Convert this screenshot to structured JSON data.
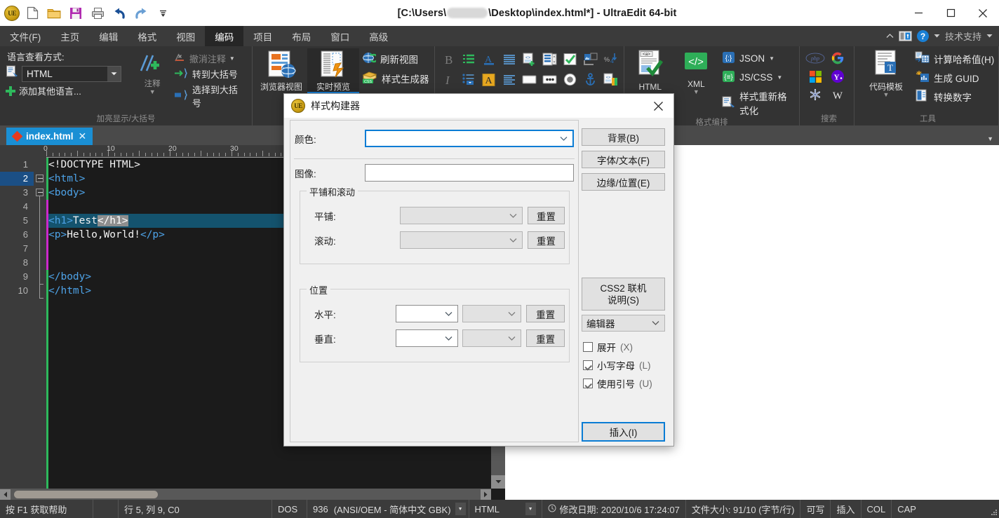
{
  "window": {
    "title_prefix": "[C:\\Users\\",
    "title_suffix": "\\Desktop\\index.html*] - UltraEdit 64-bit",
    "app_logo_text": "UE"
  },
  "quick_access": [
    {
      "name": "new-file-icon",
      "label": "新建"
    },
    {
      "name": "open-folder-icon",
      "label": "打开"
    },
    {
      "name": "save-icon",
      "label": "保存"
    },
    {
      "name": "print-icon",
      "label": "打印"
    },
    {
      "name": "undo-icon",
      "label": "撤销"
    },
    {
      "name": "redo-icon",
      "label": "重做"
    },
    {
      "name": "customize-qat-icon",
      "label": "自定义"
    }
  ],
  "window_controls": {
    "minimize": "minimize-icon",
    "maximize": "maximize-icon",
    "close": "close-icon"
  },
  "menubar": {
    "tabs": [
      {
        "label": "文件(F)",
        "active": false
      },
      {
        "label": "主页",
        "active": false
      },
      {
        "label": "编辑",
        "active": false
      },
      {
        "label": "格式",
        "active": false
      },
      {
        "label": "视图",
        "active": false
      },
      {
        "label": "编码",
        "active": true
      },
      {
        "label": "项目",
        "active": false
      },
      {
        "label": "布局",
        "active": false
      },
      {
        "label": "窗口",
        "active": false
      },
      {
        "label": "高级",
        "active": false
      }
    ],
    "support_label": "技术支持"
  },
  "ribbon": {
    "language_group": {
      "title": "语言查看方式:",
      "selected_language": "HTML",
      "add_other_language": "添加其他语言...",
      "comment_label": "注释",
      "uncomment_label": "撤消注释",
      "goto_brace": "转到大括号",
      "select_to_brace": "选择到大括号",
      "group_label": "加亮显示/大括号"
    },
    "preview_group": {
      "browser_view": "浏览器视图",
      "live_preview": "实时预览",
      "refresh_view": "刷新视图",
      "style_generator": "样式生成器"
    },
    "format_group": {
      "html_label": "HTML",
      "xml_label": "XML",
      "json_label": "JSON",
      "jscss_label": "JS/CSS",
      "style_reformat": "样式重新格式化",
      "group_label": "格式编排"
    },
    "search_group": {
      "group_label": "搜索",
      "engines": [
        "php-icon",
        "google-icon",
        "microsoft-icon",
        "yahoo-icon",
        "snowflake-icon",
        "wikipedia-icon"
      ]
    },
    "tools_group": {
      "code_template": "代码模板",
      "hash_value": "计算哈希值(H)",
      "generate_guid": "生成 GUID",
      "convert_number": "转换数字",
      "group_label": "工具"
    }
  },
  "editor": {
    "tab_label": "index.html",
    "ruler_marks": [
      "0",
      "10",
      "20",
      "30"
    ],
    "lines": [
      {
        "num": "1",
        "tokens": [
          {
            "t": "<!DOCTYPE HTML>",
            "c": "dtdc"
          }
        ]
      },
      {
        "num": "2",
        "tokens": [
          {
            "t": "<html>",
            "c": "tagc"
          }
        ]
      },
      {
        "num": "3",
        "tokens": [
          {
            "t": "<body>",
            "c": "tagc"
          }
        ]
      },
      {
        "num": "4",
        "tokens": []
      },
      {
        "num": "5",
        "tokens": [
          {
            "t": "<h1>",
            "c": "tagc"
          },
          {
            "t": "Test",
            "c": "txtc"
          },
          {
            "t": "</h1>",
            "c": "tagc"
          }
        ]
      },
      {
        "num": "6",
        "tokens": [
          {
            "t": "<p>",
            "c": "tagc"
          },
          {
            "t": "Hello,World!",
            "c": "txtc"
          },
          {
            "t": "</p>",
            "c": "tagc"
          }
        ]
      },
      {
        "num": "7",
        "tokens": []
      },
      {
        "num": "8",
        "tokens": []
      },
      {
        "num": "9",
        "tokens": [
          {
            "t": "</body>",
            "c": "tagc"
          }
        ]
      },
      {
        "num": "10",
        "tokens": [
          {
            "t": "</html>",
            "c": "tagc"
          }
        ]
      }
    ],
    "current_line": 2,
    "selected_line": 5
  },
  "statusbar": {
    "help_hint": "按 F1 获取帮助",
    "caret": "行 5, 列 9, C0",
    "line_ending": "DOS",
    "codepage": "936",
    "encoding": "(ANSI/OEM - 简体中文 GBK)",
    "syntax": "HTML",
    "modified": "修改日期: 2020/10/6 17:24:07",
    "filesize": "文件大小: 91/10 (字节/行)",
    "writable": "可写",
    "insert_mode": "插入",
    "col_mode": "COL",
    "caps": "CAP"
  },
  "dialog": {
    "title": "样式构建器",
    "color_label": "颜色:",
    "color_value": "",
    "image_label": "图像:",
    "image_value": "",
    "tile_scroll_group": "平铺和滚动",
    "tile_label": "平铺:",
    "tile_value": "",
    "scroll_label": "滚动:",
    "scroll_value": "",
    "position_group": "位置",
    "horizontal_label": "水平:",
    "horizontal_value": "",
    "horizontal_unit": "",
    "vertical_label": "垂直:",
    "vertical_value": "",
    "vertical_unit": "",
    "reset_label": "重置",
    "buttons": {
      "background": "背景(B)",
      "font_text": "字体/文本(F)",
      "border_position": "边缘/位置(E)",
      "css2_help": "CSS2 联机\n说明(S)",
      "css2_help_line1": "CSS2 联机",
      "css2_help_line2": "说明(S)",
      "insert": "插入(I)"
    },
    "target_select": "编辑器",
    "checkboxes": [
      {
        "label_main": "展开",
        "label_acc": "(X)",
        "checked": false
      },
      {
        "label_main": "小写字母",
        "label_acc": "(L)",
        "checked": true
      },
      {
        "label_main": "使用引号",
        "label_acc": "(U)",
        "checked": true
      }
    ]
  },
  "colors": {
    "accent_blue": "#1a8fd4",
    "ribbon_bg": "#333333",
    "editor_bg": "#1b1b1b",
    "tag_color": "#4ea3e8",
    "selection": "#14536e"
  }
}
